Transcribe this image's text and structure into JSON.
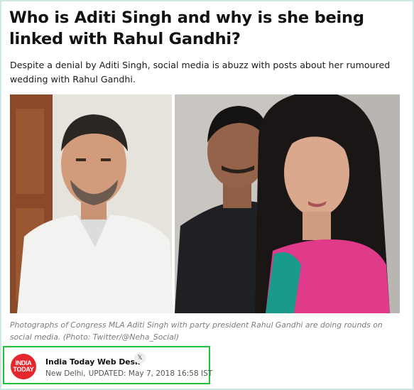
{
  "article": {
    "headline": "Who is Aditi Singh and why is she being linked with Rahul Gandhi?",
    "dek": "Despite a denial by Aditi Singh, social media is abuzz with posts about her rumoured wedding with Rahul Gandhi.",
    "photo_alt": "Photographs of Congress MLA Aditi Singh with party president Rahul Gandhi",
    "caption": "Photographs of Congress MLA Aditi Singh with party president Rahul Gandhi are doing rounds on social media. (Photo: Twitter/@Neha_Social)"
  },
  "byline": {
    "logo_line1": "INDIA",
    "logo_line2": "TODAY",
    "author": "India Today Web Desk",
    "social_icon": "x-icon",
    "social_glyph": "𝕏",
    "location": "New Delhi,",
    "updated": "UPDATED: May 7, 2018 16:58 IST"
  },
  "colors": {
    "frame_border": "#cfe7e4",
    "byline_highlight": "#22c23a",
    "logo_red": "#e4262d"
  }
}
